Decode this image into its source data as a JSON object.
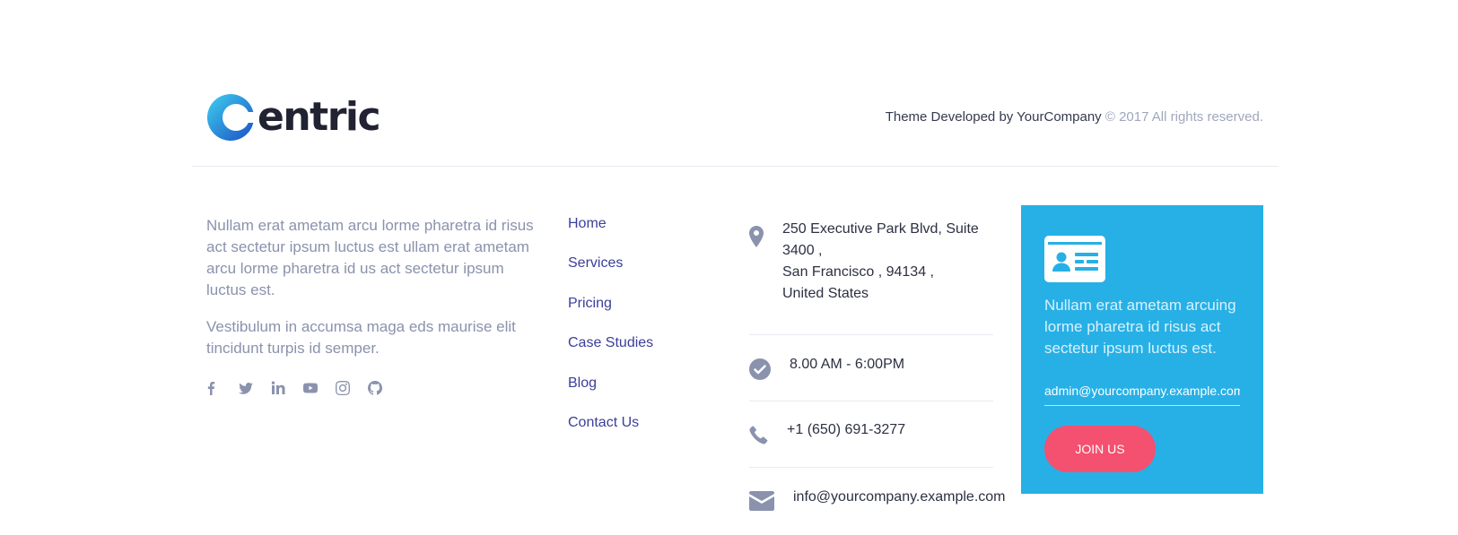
{
  "brand": {
    "name": "entric"
  },
  "copyright": {
    "developer": "Theme Developed by YourCompany",
    "rights": " © 2017 All rights reserved."
  },
  "about": {
    "paragraph1": "Nullam erat ametam arcu lorme pharetra id risus act sectetur ipsum luctus est ullam erat ametam arcu lorme pharetra id us act sectetur ipsum luctus est.",
    "paragraph2": "Vestibulum in accumsa maga eds maurise elit tincidunt turpis id semper."
  },
  "socials": [
    "facebook",
    "twitter",
    "linkedin",
    "youtube",
    "instagram",
    "github"
  ],
  "nav": [
    "Home",
    "Services",
    "Pricing",
    "Case Studies",
    "Blog",
    "Contact Us"
  ],
  "contact": {
    "address_line1": "250 Executive Park Blvd, Suite",
    "address_line2": "3400 ,",
    "address_line3": "San Francisco , 94134 ,",
    "address_line4": "United States",
    "hours": "8.00 AM - 6:00PM",
    "phone": "+1 (650) 691-3277",
    "email": "info@yourcompany.example.com"
  },
  "signup": {
    "text": "Nullam erat ametam arcuing lorme pharetra id risus act sectetur ipsum luctus est.",
    "email_value": "admin@yourcompany.example.com",
    "button": "JOIN US"
  },
  "colors": {
    "accent_blue": "#27b0e6",
    "button_pink": "#f4506f",
    "nav_link": "#3a3f9a",
    "muted_text": "#8a92ad"
  }
}
